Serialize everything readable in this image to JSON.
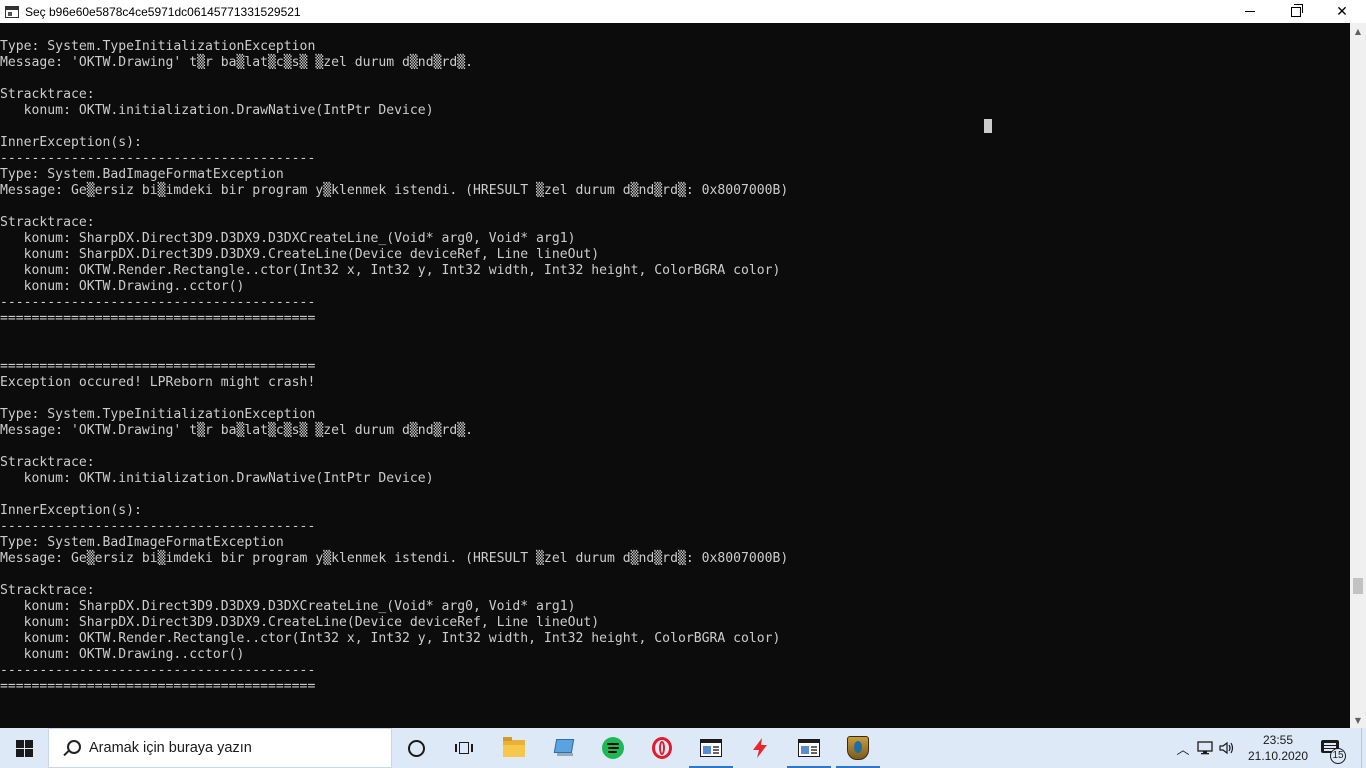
{
  "window": {
    "title": "Seç b96e60e5878c4ce5971dc06145771331529521",
    "controls": {
      "minimize": "minimize",
      "maximize": "maximize",
      "close": "close"
    }
  },
  "console": {
    "lines": [
      "Type: System.TypeInitializationException",
      "Message: 'OKTW.Drawing' t▒r ba▒lat▒c▒s▒ ▒zel durum d▒nd▒rd▒.",
      "",
      "Stracktrace:",
      "   konum: OKTW.initialization.DrawNative(IntPtr Device)",
      "",
      "InnerException(s):",
      "----------------------------------------",
      "Type: System.BadImageFormatException",
      "Message: Ge▒ersiz bi▒imdeki bir program y▒klenmek istendi. (HRESULT ▒zel durum d▒nd▒rd▒: 0x8007000B)",
      "",
      "Stracktrace:",
      "   konum: SharpDX.Direct3D9.D3DX9.D3DXCreateLine_(Void* arg0, Void* arg1)",
      "   konum: SharpDX.Direct3D9.D3DX9.CreateLine(Device deviceRef, Line lineOut)",
      "   konum: OKTW.Render.Rectangle..ctor(Int32 x, Int32 y, Int32 width, Int32 height, ColorBGRA color)",
      "   konum: OKTW.Drawing..cctor()",
      "----------------------------------------",
      "========================================",
      "",
      "",
      "========================================",
      "Exception occured! LPReborn might crash!",
      "",
      "Type: System.TypeInitializationException",
      "Message: 'OKTW.Drawing' t▒r ba▒lat▒c▒s▒ ▒zel durum d▒nd▒rd▒.",
      "",
      "Stracktrace:",
      "   konum: OKTW.initialization.DrawNative(IntPtr Device)",
      "",
      "InnerException(s):",
      "----------------------------------------",
      "Type: System.BadImageFormatException",
      "Message: Ge▒ersiz bi▒imdeki bir program y▒klenmek istendi. (HRESULT ▒zel durum d▒nd▒rd▒: 0x8007000B)",
      "",
      "Stracktrace:",
      "   konum: SharpDX.Direct3D9.D3DX9.D3DXCreateLine_(Void* arg0, Void* arg1)",
      "   konum: SharpDX.Direct3D9.D3DX9.CreateLine(Device deviceRef, Line lineOut)",
      "   konum: OKTW.Render.Rectangle..ctor(Int32 x, Int32 y, Int32 width, Int32 height, ColorBGRA color)",
      "   konum: OKTW.Drawing..cctor()",
      "----------------------------------------",
      "========================================"
    ],
    "colors": {
      "background": "#0c0c0c",
      "text": "#cccccc"
    }
  },
  "taskbar": {
    "search_placeholder": "Aramak için buraya yazın",
    "apps": [
      {
        "icon": "cortana-icon"
      },
      {
        "icon": "task-view-icon"
      },
      {
        "icon": "file-explorer-icon"
      },
      {
        "icon": "this-pc-icon"
      },
      {
        "icon": "spotify-icon"
      },
      {
        "icon": "opera-icon"
      },
      {
        "icon": "console-app-icon"
      },
      {
        "icon": "lightning-app-icon"
      },
      {
        "icon": "console-app-icon"
      },
      {
        "icon": "league-of-legends-icon"
      }
    ],
    "clock": {
      "time": "23:55",
      "date": "21.10.2020"
    },
    "notification_count": "15",
    "colors": {
      "accent": "#2f78c8",
      "background": "#dde9f6"
    }
  }
}
